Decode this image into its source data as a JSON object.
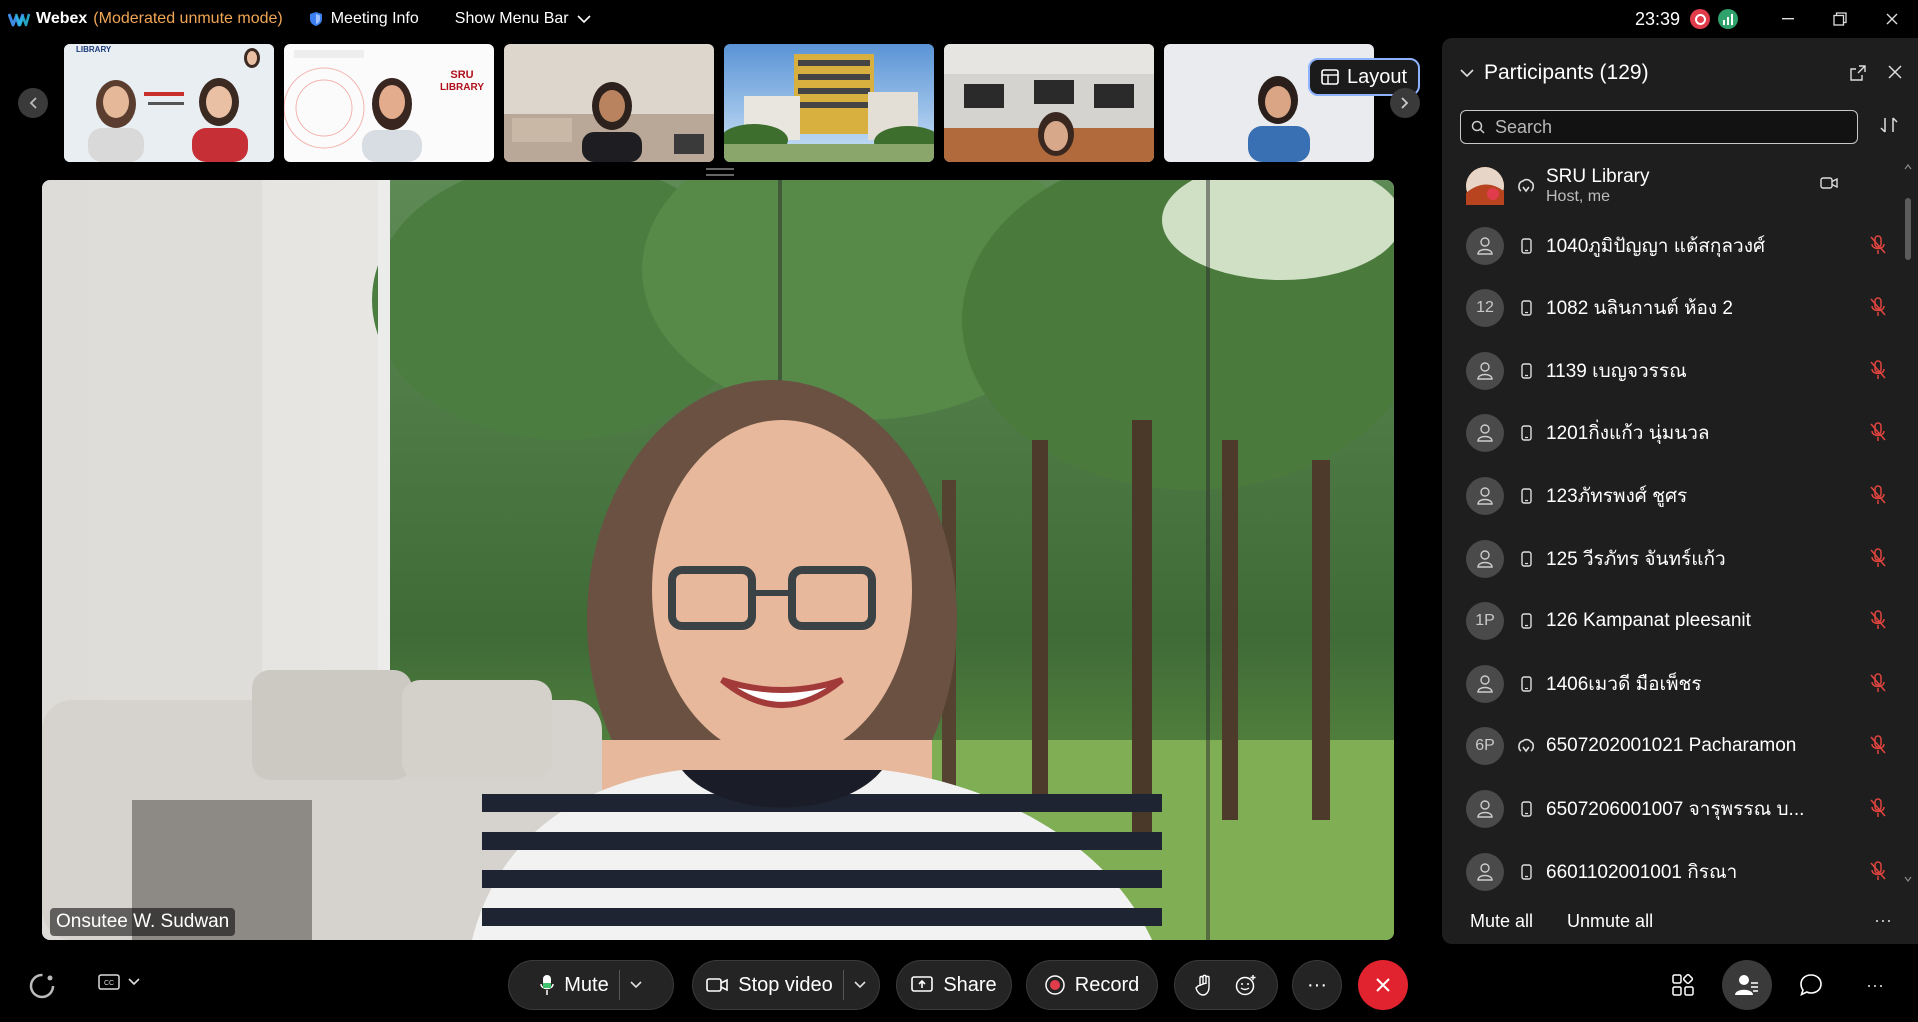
{
  "titlebar": {
    "app_name": "Webex",
    "mode": "(Moderated unmute mode)",
    "meeting_info": "Meeting Info",
    "show_menu_bar": "Show Menu Bar",
    "time": "23:39"
  },
  "filmstrip": {
    "layout_label": "Layout",
    "thumb_texts": {
      "t1_logo": "LIBRARY",
      "t2_sru": "SRU",
      "t2_library": "LIBRARY"
    }
  },
  "main_video": {
    "speaker_name": "Onsutee W. Sudwan"
  },
  "participants": {
    "title": "Participants (129)",
    "search_placeholder": "Search",
    "items": [
      {
        "avatar": "",
        "device": "desktop",
        "name": "SRU Library",
        "role": "Host, me",
        "status": "video"
      },
      {
        "avatar": "",
        "device": "phone",
        "name": "1040ภูมิปัญญา แต้สกุลวงศ์",
        "status": "muted"
      },
      {
        "avatar": "12",
        "device": "phone",
        "name": "1082 นลินกานต์ ห้อง 2",
        "status": "muted"
      },
      {
        "avatar": "",
        "device": "phone",
        "name": "1139 เบญจวรรณ",
        "status": "muted"
      },
      {
        "avatar": "",
        "device": "phone",
        "name": "1201กิ่งแก้ว นุ่มนวล",
        "status": "muted"
      },
      {
        "avatar": "",
        "device": "phone",
        "name": "123ภัทรพงศ์ ชูศร",
        "status": "muted"
      },
      {
        "avatar": "",
        "device": "phone",
        "name": "125 วีรภัทร จันทร์แก้ว",
        "status": "muted"
      },
      {
        "avatar": "1P",
        "device": "phone",
        "name": "126 Kampanat pleesanit",
        "status": "muted"
      },
      {
        "avatar": "",
        "device": "phone",
        "name": "1406เมวดี มือเพ็ชร",
        "status": "muted"
      },
      {
        "avatar": "6P",
        "device": "desktop",
        "name": "6507202001021 Pacharamon",
        "status": "muted"
      },
      {
        "avatar": "",
        "device": "phone",
        "name": "6507206001007 จารุพรรณ บ...",
        "status": "muted"
      },
      {
        "avatar": "",
        "device": "phone",
        "name": "6601102001001 กิรณา",
        "status": "muted"
      }
    ],
    "mute_all": "Mute all",
    "unmute_all": "Unmute all",
    "more": "···"
  },
  "controls": {
    "mute": "Mute",
    "stop_video": "Stop video",
    "share": "Share",
    "record": "Record",
    "more": "···"
  },
  "colors": {
    "mode_text": "#f0a654",
    "record_dot": "#e03c4b",
    "leave_button": "#e0232e",
    "layout_border": "#8eb2ff"
  }
}
